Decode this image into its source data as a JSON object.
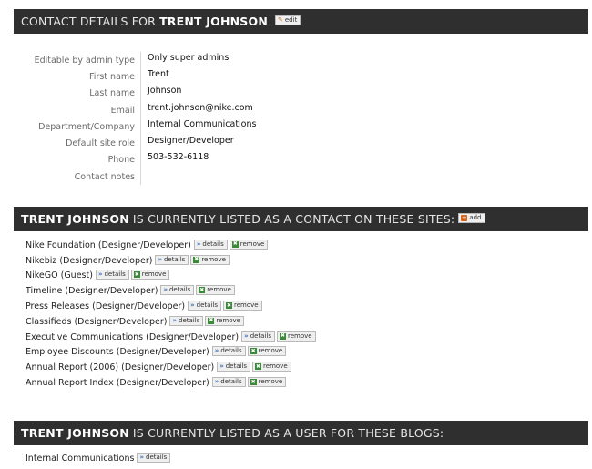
{
  "contact_header": {
    "prefix": "Contact details for",
    "name": "Trent Johnson",
    "edit_label": "edit"
  },
  "details": [
    {
      "label": "Editable by admin type",
      "value": "Only super admins"
    },
    {
      "label": "First name",
      "value": "Trent"
    },
    {
      "label": "Last name",
      "value": "Johnson"
    },
    {
      "label": "Email",
      "value": "trent.johnson@nike.com"
    },
    {
      "label": "Department/Company",
      "value": "Internal Communications"
    },
    {
      "label": "Default site role",
      "value": "Designer/Developer"
    },
    {
      "label": "Phone",
      "value": "503-532-6118"
    },
    {
      "label": "Contact notes",
      "value": ""
    }
  ],
  "sites_header": {
    "name": "Trent Johnson",
    "suffix": "is currently listed as a contact on these sites:",
    "add_label": "add"
  },
  "sites": [
    {
      "name": "Nike Foundation (Designer/Developer)"
    },
    {
      "name": "Nikebiz (Designer/Developer)"
    },
    {
      "name": "NikeGO (Guest)"
    },
    {
      "name": "Timeline (Designer/Developer)"
    },
    {
      "name": "Press Releases (Designer/Developer)"
    },
    {
      "name": "Classifieds (Designer/Developer)"
    },
    {
      "name": "Executive Communications (Designer/Developer)"
    },
    {
      "name": "Employee Discounts (Designer/Developer)"
    },
    {
      "name": "Annual Report (2006) (Designer/Developer)"
    },
    {
      "name": "Annual Report Index (Designer/Developer)"
    }
  ],
  "blogs_header": {
    "name": "Trent Johnson",
    "suffix": "is currently listed as a user for these blogs:"
  },
  "blogs": [
    {
      "name": "Internal Communications"
    }
  ],
  "chips": {
    "details_label": "details",
    "remove_label": "remove"
  }
}
